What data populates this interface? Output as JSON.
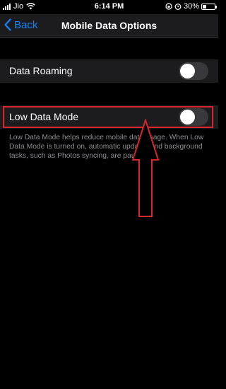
{
  "status_bar": {
    "carrier": "Jio",
    "time": "6:14 PM",
    "battery_percent": "30%",
    "battery_level": 0.3,
    "icons": [
      "signal-bars-icon",
      "wifi-icon",
      "rotation-lock-icon",
      "alarm-icon",
      "battery-icon"
    ]
  },
  "nav": {
    "back_label": "Back",
    "title": "Mobile Data Options"
  },
  "rows": {
    "data_roaming": {
      "label": "Data Roaming",
      "enabled": false
    },
    "low_data_mode": {
      "label": "Low Data Mode",
      "enabled": false
    }
  },
  "low_data_mode_description": "Low Data Mode helps reduce mobile data usage. When Low Data Mode is turned on, automatic updates and background tasks, such as Photos syncing, are paused.",
  "colors": {
    "accent": "#0a84ff",
    "annotation": "#d9262c",
    "toggle_off": "#39393d",
    "cell_background": "#1c1c1e"
  }
}
